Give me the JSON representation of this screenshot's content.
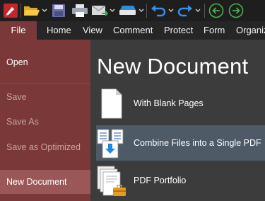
{
  "toolbar": {
    "items": [
      "app-logo",
      "open-folder-icon",
      "save-icon",
      "print-icon",
      "email-icon",
      "scan-icon",
      "undo-icon",
      "redo-icon",
      "back-icon",
      "forward-icon"
    ]
  },
  "tabs": [
    {
      "label": "File"
    },
    {
      "label": "Home"
    },
    {
      "label": "View"
    },
    {
      "label": "Comment"
    },
    {
      "label": "Protect"
    },
    {
      "label": "Form"
    },
    {
      "label": "Organiz"
    }
  ],
  "sidebar": {
    "items": [
      {
        "label": "Open",
        "enabled": true
      },
      {
        "label": "Save",
        "enabled": false
      },
      {
        "label": "Save As",
        "enabled": false
      },
      {
        "label": "Save as Optimized",
        "enabled": false
      },
      {
        "label": "New Document",
        "enabled": true,
        "selected": true
      }
    ]
  },
  "main": {
    "title": "New Document",
    "options": [
      {
        "label": "With Blank Pages",
        "icon": "blank-page-icon"
      },
      {
        "label": "Combine Files into a Single PDF",
        "icon": "combine-files-icon",
        "highlighted": true
      },
      {
        "label": "PDF Portfolio",
        "icon": "pdf-portfolio-icon"
      }
    ]
  },
  "colors": {
    "file_tab": "#7a3838",
    "sidebar": "#7a3838",
    "sidebar_selected": "#9b5757",
    "main_bg": "#3c3c3c",
    "highlight": "#4e5a66",
    "toolbar_bg": "#1e1e1e"
  }
}
